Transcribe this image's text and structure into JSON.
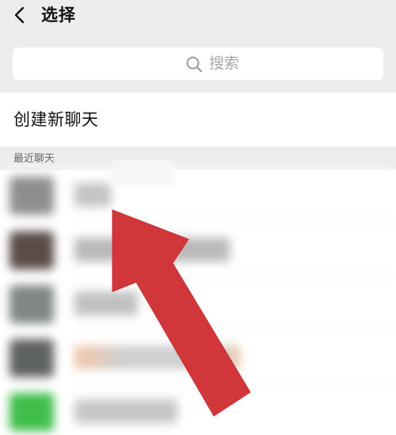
{
  "nav": {
    "title": "选择",
    "back_icon": "chevron-left-icon"
  },
  "search": {
    "placeholder": "搜索",
    "icon": "search-icon"
  },
  "new_chat": {
    "label": "创建新聊天"
  },
  "recent": {
    "header": "最近聊天"
  },
  "annotation": {
    "icon": "red-arrow-icon",
    "color": "#d0373a"
  },
  "colors": {
    "background": "#ededed",
    "text": "#111111",
    "placeholder": "#a8a8a8"
  }
}
